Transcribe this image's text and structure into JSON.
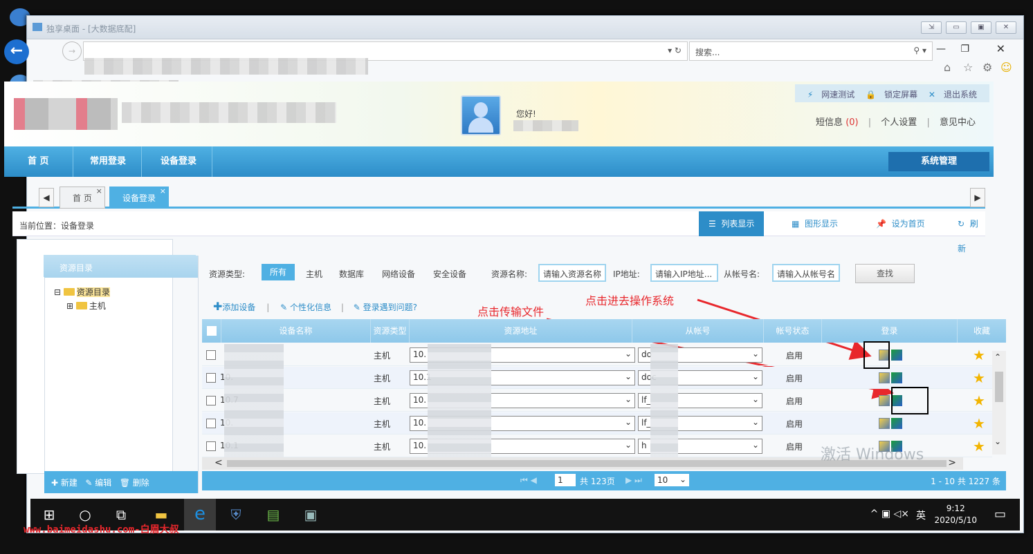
{
  "window": {
    "title": "独享桌面 - [大数据底配]"
  },
  "browser": {
    "search_placeholder": "搜索..."
  },
  "header": {
    "greeting": "您好!",
    "toolbar": [
      "网速测试",
      "锁定屏幕",
      "退出系统"
    ],
    "links": {
      "messages": "短信息",
      "message_count": "(0)",
      "personal": "个人设置",
      "feedback": "意见中心"
    }
  },
  "nav": {
    "items": [
      "首 页",
      "常用登录",
      "设备登录"
    ],
    "system": "系统管理"
  },
  "tabs": [
    {
      "label": "首 页"
    },
    {
      "label": "设备登录"
    }
  ],
  "crumb": {
    "label": "当前位置：",
    "value": "设备登录"
  },
  "views": {
    "list": "列表显示",
    "graph": "图形显示",
    "home": "设为首页",
    "refresh": "刷新"
  },
  "left_panel": {
    "title": "资源目录",
    "root": "资源目录",
    "child": "主机",
    "footer": {
      "new": "新建",
      "edit": "编辑",
      "delete": "删除"
    }
  },
  "filter": {
    "type_label": "资源类型:",
    "types": [
      "所有",
      "主机",
      "数据库",
      "网络设备",
      "安全设备"
    ],
    "name_label": "资源名称:",
    "name_placeholder": "请输入资源名称",
    "ip_label": "IP地址:",
    "ip_placeholder": "请输入IP地址...",
    "account_label": "从帐号名:",
    "account_placeholder": "请输入从帐号名",
    "query": "查找"
  },
  "tools": {
    "add": "添加设备",
    "info": "个性化信息",
    "problem": "登录遇到问题?"
  },
  "annotations": {
    "transfer": "点击传输文件",
    "enter": "点击进去操作系统"
  },
  "table": {
    "headers": [
      "设备名称",
      "资源类型",
      "资源地址",
      "从帐号",
      "帐号状态",
      "登录",
      "收藏"
    ],
    "rows": [
      {
        "name": "",
        "type": "主机",
        "addr": "10.",
        "account": "do",
        "status": "启用"
      },
      {
        "name": "10.",
        "type": "主机",
        "addr": "10.1",
        "account": "doc",
        "status": "启用"
      },
      {
        "name": "10.7",
        "type": "主机",
        "addr": "10.",
        "account": "lf_",
        "status": "启用"
      },
      {
        "name": "10.",
        "type": "主机",
        "addr": "10.",
        "account": "lf_",
        "status": "启用"
      },
      {
        "name": "10.1",
        "type": "主机",
        "addr": "10.",
        "account": "h",
        "status": "启用"
      }
    ]
  },
  "pager": {
    "page": "1",
    "total_pages": "共 123页",
    "size": "10",
    "summary": "1 - 10  共 1227 条"
  },
  "watermark": "激活 Windows",
  "taskbar": {
    "lang": "英",
    "time": "9:12",
    "date": "2020/5/10"
  },
  "site": "www.baimeidashu.com-白眉大叔"
}
